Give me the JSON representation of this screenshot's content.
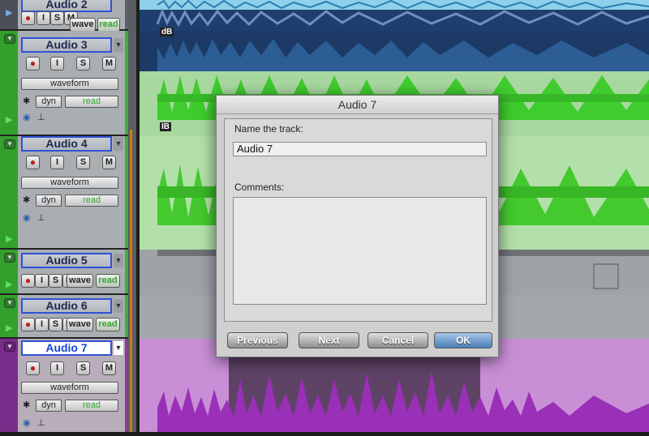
{
  "tracks": [
    {
      "name": "Audio 2",
      "color": "gray",
      "buttons": {
        "s": "S",
        "m": "M",
        "i": "I",
        "wave": "wave",
        "read": "read"
      }
    },
    {
      "name": "Audio 3",
      "color": "green",
      "view": "waveform",
      "dyn": "dyn",
      "read": "read",
      "i": "I",
      "s": "S",
      "m": "M"
    },
    {
      "name": "Audio 4",
      "color": "green",
      "view": "waveform",
      "dyn": "dyn",
      "read": "read",
      "i": "I",
      "s": "S",
      "m": "M"
    },
    {
      "name": "Audio 5",
      "color": "green",
      "i": "I",
      "s": "S",
      "m": "M",
      "wave": "wave",
      "read": "read"
    },
    {
      "name": "Audio 6",
      "color": "green",
      "i": "I",
      "s": "S",
      "m": "M",
      "wave": "wave",
      "read": "read"
    },
    {
      "name": "Audio 7",
      "color": "purple",
      "view": "waveform",
      "dyn": "dyn",
      "read": "read",
      "i": "I",
      "s": "S",
      "m": "M"
    }
  ],
  "lane_labels": {
    "db1": "dB",
    "db2": "IB"
  },
  "dialog": {
    "title": "Audio 7",
    "name_label": "Name the track:",
    "name_value": "Audio 7",
    "comments_label": "Comments:",
    "comments_value": "",
    "buttons": {
      "previous": "Previous",
      "next": "Next",
      "cancel": "Cancel",
      "ok": "OK"
    }
  },
  "colors": {
    "green": "#3fae3a",
    "purple": "#8a3a9a",
    "blue_lane": "#1e3f6e",
    "ok_button": "#4a7fb5"
  }
}
